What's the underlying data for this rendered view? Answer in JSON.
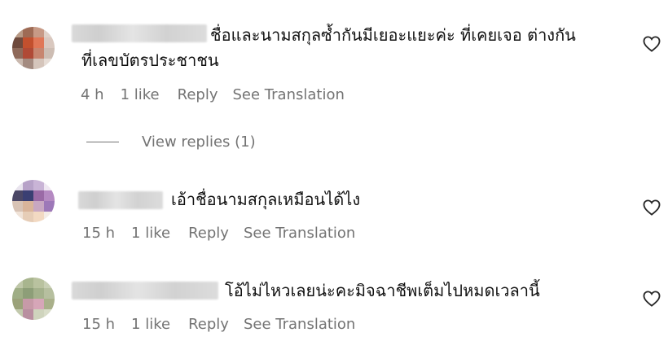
{
  "comments": [
    {
      "text_lines": [
        "ชื่อและนามสกุลซ้ำกันมีเยอะแยะค่ะ ที่เคยเจอ ต่างกัน",
        "ที่เลขบัตรประชาชน"
      ],
      "time": "4 h",
      "likes": "1 like",
      "reply": "Reply",
      "translate": "See Translation",
      "view_replies": "View replies (1)"
    },
    {
      "text_lines": [
        "เอ้าชื่อนามสกุลเหมือนได้ไง"
      ],
      "time": "15 h",
      "likes": "1 like",
      "reply": "Reply",
      "translate": "See Translation"
    },
    {
      "text_lines": [
        "โอ้ไม่ไหวเลยน่ะคะมิจฉาชีพเต็มไปหมดเวลานี้"
      ],
      "time": "15 h",
      "likes": "1 like",
      "reply": "Reply",
      "translate": "See Translation"
    }
  ],
  "icons": {
    "like": "heart-outline-icon"
  },
  "colors": {
    "text": "#111111",
    "meta": "#737373"
  }
}
